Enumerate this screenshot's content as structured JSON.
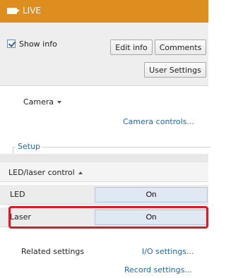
{
  "header": {
    "title": "LIVE",
    "camera_icon": "video-camera-icon"
  },
  "top_panel": {
    "show_info": {
      "label": "Show info",
      "checked": true
    },
    "edit_info_label": "Edit info",
    "comments_label": "Comments",
    "user_settings_label": "User Settings"
  },
  "camera": {
    "label": "Camera",
    "camera_controls_link": "Camera controls..."
  },
  "setup": {
    "label": "Setup"
  },
  "led_laser": {
    "header": "LED/laser control",
    "rows": [
      {
        "label": "LED",
        "button": "On"
      },
      {
        "label": "Laser",
        "button": "On"
      }
    ]
  },
  "related": {
    "label": "Related settings",
    "io_link": "I/O settings...",
    "record_link": "Record settings..."
  },
  "colors": {
    "header_bg": "#de8e1f",
    "link": "#1f67b5",
    "highlight": "#d21f2a",
    "on_button": "#dfe8f3"
  }
}
